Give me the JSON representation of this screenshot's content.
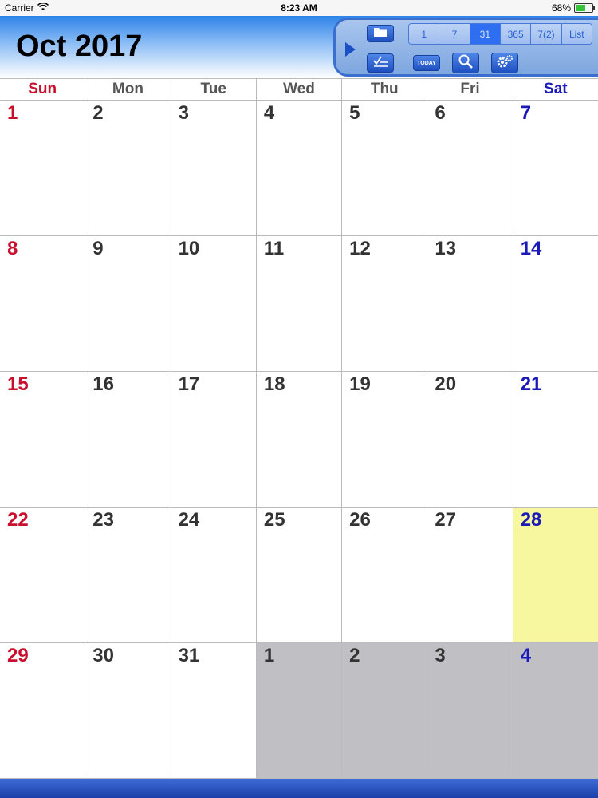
{
  "status": {
    "carrier": "Carrier",
    "time": "8:23 AM",
    "battery": "68%",
    "battery_level": 0.68
  },
  "header": {
    "title": "Oct 2017"
  },
  "toolbar": {
    "view_options": [
      "1",
      "7",
      "31",
      "365",
      "7(2)",
      "List"
    ],
    "active_view": "31",
    "today_label": "TODAY",
    "icons": {
      "play": "play-icon",
      "folder": "folder-icon",
      "tasks": "checklist-icon",
      "search": "search-icon",
      "settings": "gear-icon"
    }
  },
  "calendar": {
    "day_names": [
      "Sun",
      "Mon",
      "Tue",
      "Wed",
      "Thu",
      "Fri",
      "Sat"
    ],
    "weeks": [
      [
        "1",
        "2",
        "3",
        "4",
        "5",
        "6",
        "7"
      ],
      [
        "8",
        "9",
        "10",
        "11",
        "12",
        "13",
        "14"
      ],
      [
        "15",
        "16",
        "17",
        "18",
        "19",
        "20",
        "21"
      ],
      [
        "22",
        "23",
        "24",
        "25",
        "26",
        "27",
        "28"
      ],
      [
        "29",
        "30",
        "31",
        "1",
        "2",
        "3",
        "4"
      ]
    ],
    "today": "28",
    "colors": {
      "sunday": "#c8102e",
      "saturday": "#1a1ab8",
      "today_bg": "#f7f79f",
      "other_month_bg": "#c0bfc3"
    }
  }
}
